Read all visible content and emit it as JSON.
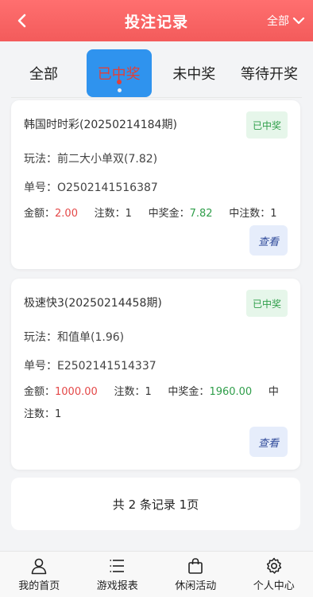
{
  "header": {
    "title": "投注记录",
    "filter_label": "全部"
  },
  "tabs": [
    {
      "label": "全部"
    },
    {
      "label": "已中奖"
    },
    {
      "label": "未中奖"
    },
    {
      "label": "等待开奖"
    }
  ],
  "records": [
    {
      "title": "韩国时时彩(20250214184期)",
      "status": "已中奖",
      "play_label": "玩法：",
      "play_value": "前二大小单双(7.82)",
      "order_label": "单号：",
      "order_value": "O2502141516387",
      "amount_label": "金额：",
      "amount_value": "2.00",
      "count_label": "注数：",
      "count_value": "1",
      "prize_label": "中奖金：",
      "prize_value": "7.82",
      "win_count_label": "中注数：",
      "win_count_value": "1",
      "view_label": "查看"
    },
    {
      "title": "极速快3(20250214458期)",
      "status": "已中奖",
      "play_label": "玩法：",
      "play_value": "和值单(1.96)",
      "order_label": "单号：",
      "order_value": "E2502141514337",
      "amount_label": "金额：",
      "amount_value": "1000.00",
      "count_label": "注数：",
      "count_value": "1",
      "prize_label": "中奖金：",
      "prize_value": "1960.00",
      "win_count_label": "中注数：",
      "win_count_value": "1",
      "view_label": "查看"
    }
  ],
  "summary": "共 2 条记录 1页",
  "nav": [
    {
      "label": "我的首页",
      "icon": "person-icon"
    },
    {
      "label": "游戏报表",
      "icon": "list-icon"
    },
    {
      "label": "休闲活动",
      "icon": "bag-icon"
    },
    {
      "label": "个人中心",
      "icon": "gear-icon"
    }
  ],
  "colors": {
    "header": "#f35b5b",
    "active_tab": "#2f93ee",
    "win": "#2f9e4a",
    "amount": "#e44848"
  }
}
